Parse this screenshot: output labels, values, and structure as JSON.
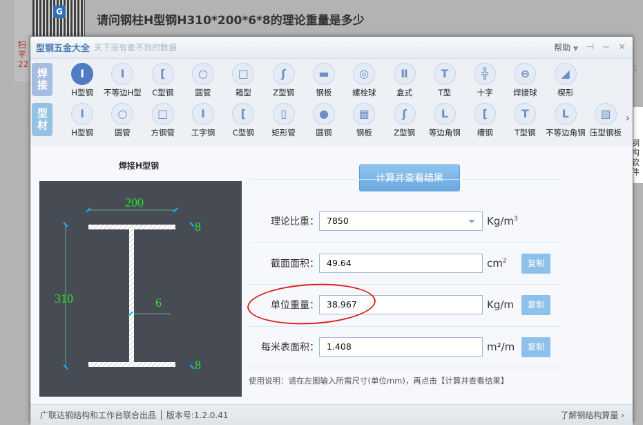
{
  "background": {
    "question": "请问钢柱H型钢H310*200*6*8的理论重量是多少",
    "qr_red_text": "扫平22",
    "qr_logo": "G",
    "warn_icon": "warning-icon"
  },
  "window": {
    "title": "型钢五金大全",
    "slogan": "天下没有查不到的数据",
    "help": "帮助",
    "pin": "⊣",
    "minimize": "−",
    "close": "✕"
  },
  "categories": [
    {
      "label": "焊接",
      "items": [
        {
          "l": "H型钢",
          "g": "I"
        },
        {
          "l": "不等边H型",
          "g": "I"
        },
        {
          "l": "C型钢",
          "g": "["
        },
        {
          "l": "圆管",
          "g": "○"
        },
        {
          "l": "箱型",
          "g": "□"
        },
        {
          "l": "Z型钢",
          "g": "ʃ"
        },
        {
          "l": "钢板",
          "g": "▬"
        },
        {
          "l": "螺栓球",
          "g": "◎"
        },
        {
          "l": "盒式",
          "g": "Ⅱ"
        },
        {
          "l": "T型",
          "g": "T"
        },
        {
          "l": "十字",
          "g": "╬"
        },
        {
          "l": "焊接球",
          "g": "⊖"
        },
        {
          "l": "楔形",
          "g": "◢"
        }
      ]
    },
    {
      "label": "型材",
      "items": [
        {
          "l": "H型钢",
          "g": "I"
        },
        {
          "l": "圆管",
          "g": "○"
        },
        {
          "l": "方钢管",
          "g": "□"
        },
        {
          "l": "工字钢",
          "g": "I"
        },
        {
          "l": "C型钢",
          "g": "["
        },
        {
          "l": "矩形管",
          "g": "▯"
        },
        {
          "l": "圆钢",
          "g": "●"
        },
        {
          "l": "钢板",
          "g": "▦"
        },
        {
          "l": "Z型钢",
          "g": "ʃ"
        },
        {
          "l": "等边角钢",
          "g": "L"
        },
        {
          "l": "槽钢",
          "g": "["
        },
        {
          "l": "T型钢",
          "g": "T"
        },
        {
          "l": "不等边角钢",
          "g": "L"
        },
        {
          "l": "压型钢板",
          "g": "▨"
        }
      ]
    }
  ],
  "more": "›",
  "diagram": {
    "title": "焊接H型钢",
    "width": "200",
    "height": "310",
    "web": "6",
    "flange_top": "8",
    "flange_bottom": "8"
  },
  "calc_button": "计算并查看结果",
  "fields": [
    {
      "label": "理论比重：",
      "value": "7850",
      "unit": "Kg/m",
      "sup": "3"
    },
    {
      "label": "截面面积：",
      "value": "49.64",
      "unit": "cm",
      "sup": "2",
      "copy": "复制"
    },
    {
      "label": "单位重量：",
      "value": "38.967",
      "unit": "Kg/m",
      "sup": "",
      "copy": "复制"
    },
    {
      "label": "每米表面积：",
      "value": "1.408",
      "unit": "m²/m",
      "sup": "",
      "copy": "复制"
    }
  ],
  "note": "使用说明：请在左图输入所需尺寸(单位mm)，再点击【计算并查看结果】",
  "footer": {
    "left": "广联达钢结构和工作台联合出品 │ 版本号:1.2.0.41",
    "right": "了解钢结构算量 ›"
  },
  "mascot": "钢构软件"
}
